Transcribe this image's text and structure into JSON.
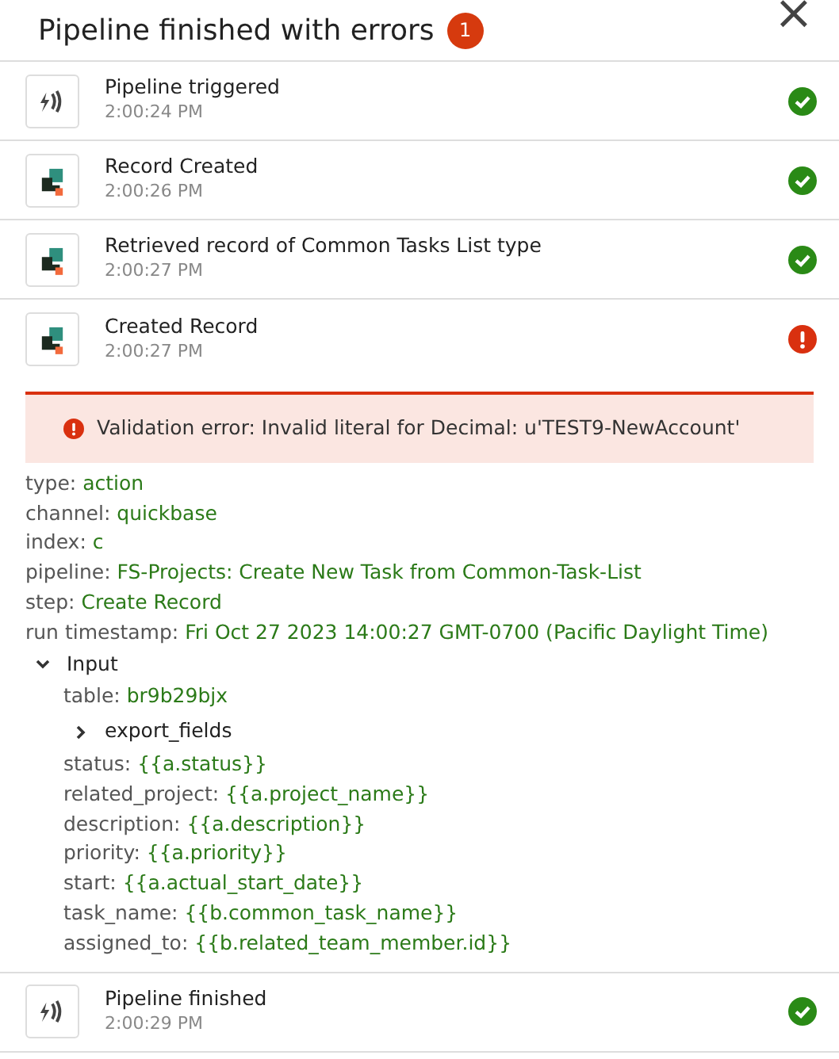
{
  "header": {
    "title": "Pipeline finished with errors",
    "error_count": "1",
    "close": "×"
  },
  "steps": [
    {
      "kind": "trigger",
      "title": "Pipeline triggered",
      "time": "2:00:24 PM",
      "failed": false
    },
    {
      "kind": "record",
      "title": "Record Created",
      "time": "2:00:26 PM",
      "failed": false
    },
    {
      "kind": "record",
      "title": "Retrieved record of Common Tasks List type",
      "time": "2:00:27 PM",
      "failed": false
    },
    {
      "kind": "record",
      "title": "Created Record",
      "time": "2:00:27 PM",
      "failed": true,
      "expanded": true,
      "error": "Validation error: Invalid literal for Decimal: u'TEST9-NewAccount'",
      "details": [
        {
          "key": "type:",
          "value": "action"
        },
        {
          "key": "channel:",
          "value": "quickbase"
        },
        {
          "key": "index:",
          "value": "c"
        },
        {
          "key": "pipeline:",
          "value": "FS-Projects: Create New Task from Common-Task-List"
        },
        {
          "key": "step:",
          "value": "Create Record"
        },
        {
          "key": "run timestamp:",
          "value": "Fri Oct 27 2023 14:00:27 GMT-0700 (Pacific Daylight Time)"
        }
      ],
      "input": {
        "label": "Input",
        "expanded": true,
        "children": [
          {
            "kind": "field",
            "key": "table:",
            "value": "br9b29bjx"
          },
          {
            "kind": "group",
            "label": "export_fields",
            "expanded": false
          },
          {
            "kind": "field",
            "key": "status:",
            "value": "{{a.status}}"
          },
          {
            "kind": "field",
            "key": "related_project:",
            "value": "{{a.project_name}}"
          },
          {
            "kind": "field",
            "key": "description:",
            "value": "{{a.description}}"
          },
          {
            "kind": "field",
            "key": "priority:",
            "value": "{{a.priority}}"
          },
          {
            "kind": "field",
            "key": "start:",
            "value": "{{a.actual_start_date}}"
          },
          {
            "kind": "field",
            "key": "task_name:",
            "value": "{{b.common_task_name}}"
          },
          {
            "kind": "field",
            "key": "assigned_to:",
            "value": "{{b.related_team_member.id}}"
          }
        ]
      }
    },
    {
      "kind": "trigger",
      "title": "Pipeline finished",
      "time": "2:00:29 PM",
      "failed": false
    }
  ]
}
